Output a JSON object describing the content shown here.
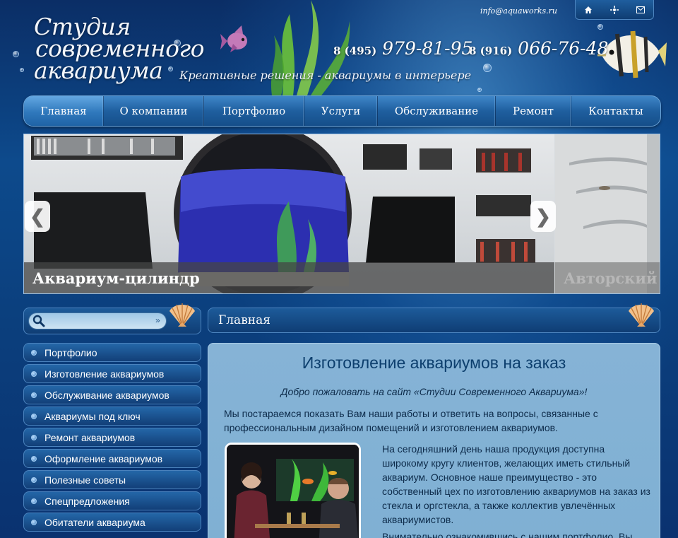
{
  "header": {
    "logo_lines": [
      "Студия",
      "современного",
      "аквариума"
    ],
    "tagline": "Креативные решения - аквариумы в интерьере",
    "email": "info@aquaworks.ru",
    "phones": [
      {
        "code": "8 (495)",
        "number": "979-81-95"
      },
      {
        "code": "8 (916)",
        "number": "066-76-48"
      }
    ],
    "top_icons": [
      "home-icon",
      "sitemap-icon",
      "mail-icon"
    ]
  },
  "nav": {
    "items": [
      {
        "label": "Главная",
        "active": true
      },
      {
        "label": "О компании"
      },
      {
        "label": "Портфолио"
      },
      {
        "label": "Услуги"
      },
      {
        "label": "Обслуживание"
      },
      {
        "label": "Ремонт"
      },
      {
        "label": "Контакты"
      }
    ]
  },
  "slider": {
    "current_caption": "Аквариум-цилиндр",
    "next_caption": "Авторский д",
    "prev_arrow": "❮",
    "next_arrow": "❯"
  },
  "search": {
    "value": "",
    "go": "»"
  },
  "sidebar": {
    "items": [
      {
        "label": "Портфолио"
      },
      {
        "label": "Изготовление аквариумов"
      },
      {
        "label": "Обслуживание аквариумов"
      },
      {
        "label": "Аквариумы под ключ"
      },
      {
        "label": "Ремонт аквариумов"
      },
      {
        "label": "Оформление аквариумов"
      },
      {
        "label": "Полезные советы"
      },
      {
        "label": "Спецпредложения"
      },
      {
        "label": "Обитатели аквариума"
      }
    ]
  },
  "content": {
    "breadcrumb": "Главная",
    "title": "Изготовление аквариумов на заказ",
    "welcome": "Добро пожаловать на сайт «Студии Современного Аквариума»!",
    "para1": "Мы постараемся показать Вам наши работы и ответить на вопросы, связанные с профессиональным дизайном помещений и изготовлением аквариумов.",
    "para2": "На сегодняшний день наша продукция доступна широкому кругу клиентов, желающих иметь стильный аквариум. Основное наше преимущество - это собственный цех по изготовлению аквариумов на заказ из стекла и оргстекла, а также коллектив увлечённых аквариумистов.",
    "para3": "Внимательно ознакомившись с нашим портфолио, Вы"
  },
  "colors": {
    "accent": "#1f5f9f",
    "content_bg": "#86b3d6",
    "title": "#0d3f6e"
  }
}
